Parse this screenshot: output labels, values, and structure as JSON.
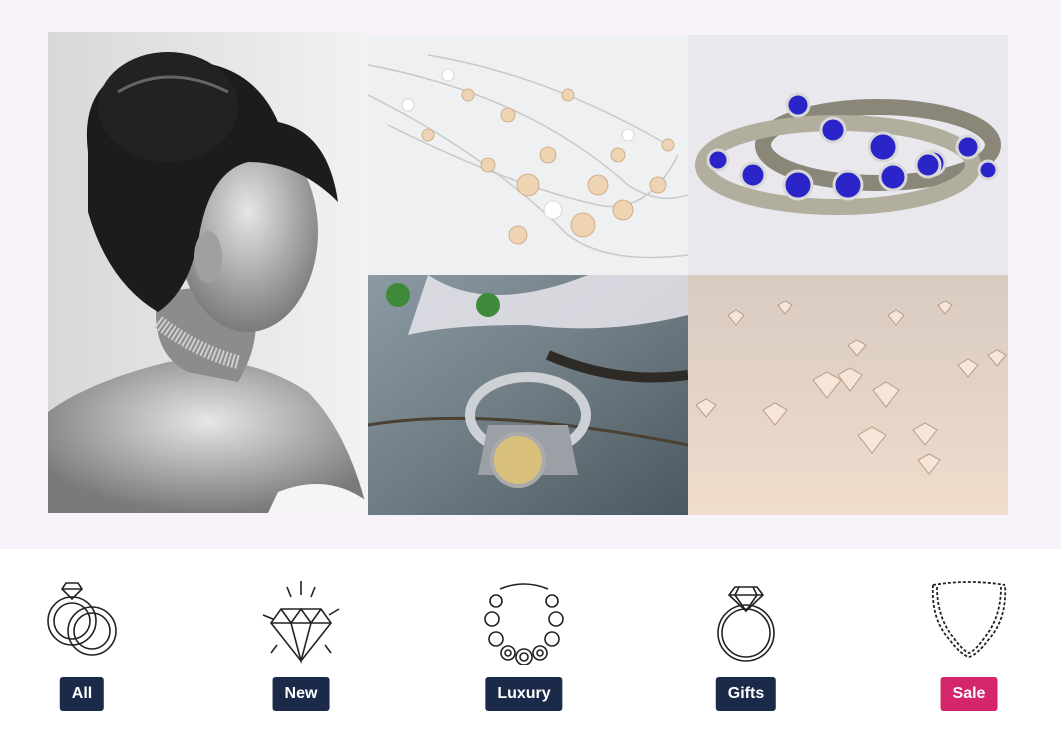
{
  "gallery": {
    "images": [
      {
        "name": "portrait-photo"
      },
      {
        "name": "pearl-necklace-photo"
      },
      {
        "name": "sapphire-bangles-photo"
      },
      {
        "name": "vintage-ring-photo"
      },
      {
        "name": "loose-diamonds-photo"
      }
    ]
  },
  "categories": [
    {
      "label": "All",
      "icon": "linked-rings-icon"
    },
    {
      "label": "New",
      "icon": "sparkling-diamond-icon"
    },
    {
      "label": "Luxury",
      "icon": "ornate-necklace-icon"
    },
    {
      "label": "Gifts",
      "icon": "diamond-ring-icon"
    },
    {
      "label": "Sale",
      "icon": "chain-necklace-icon",
      "color": "#d3266b"
    }
  ],
  "colors": {
    "button": "#1b2a48",
    "sale": "#d3266b",
    "hero_bg": "#f8f3fa"
  }
}
